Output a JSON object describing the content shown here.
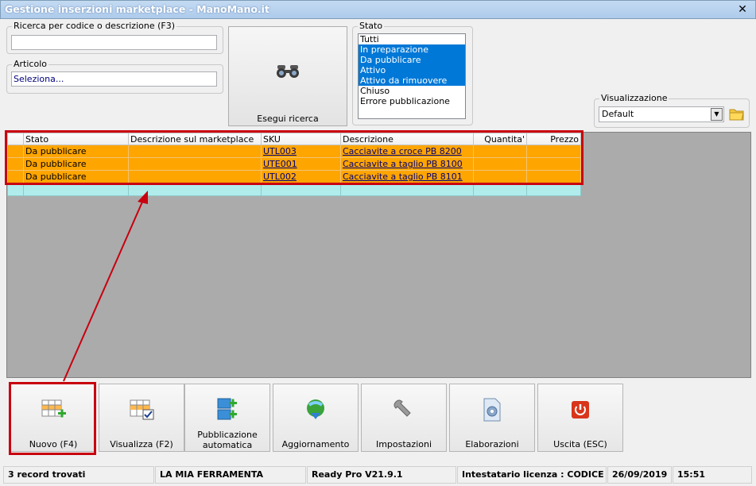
{
  "window": {
    "title": "Gestione inserzioni marketplace - ManoMano.it",
    "close_glyph": "✕"
  },
  "search": {
    "legend": "Ricerca per codice o descrizione (F3)",
    "value": ""
  },
  "article": {
    "legend": "Articolo",
    "value": "Seleziona..."
  },
  "search_button": {
    "label": "Esegui ricerca",
    "icon": "binoculars-icon"
  },
  "stato": {
    "legend": "Stato",
    "options": [
      {
        "label": "Tutti",
        "selected": false
      },
      {
        "label": "In preparazione",
        "selected": true
      },
      {
        "label": "Da pubblicare",
        "selected": true
      },
      {
        "label": "Attivo",
        "selected": true
      },
      {
        "label": "Attivo da rimuovere",
        "selected": true
      },
      {
        "label": "Chiuso",
        "selected": false
      },
      {
        "label": "Errore pubblicazione",
        "selected": false
      }
    ]
  },
  "visualizzazione": {
    "legend": "Visualizzazione",
    "value": "Default"
  },
  "grid": {
    "columns": [
      "Stato",
      "Descrizione sul marketplace",
      "SKU",
      "Descrizione",
      "Quantita'",
      "Prezzo"
    ],
    "rows": [
      {
        "stato": "Da pubblicare",
        "desc_marketplace": "",
        "sku": "UTL003",
        "descrizione": "Cacciavite a croce PB 8200",
        "quantita": "",
        "prezzo": ""
      },
      {
        "stato": "Da pubblicare",
        "desc_marketplace": "",
        "sku": "UTE001",
        "descrizione": "Cacciavite a taglio PB 8100",
        "quantita": "",
        "prezzo": ""
      },
      {
        "stato": "Da pubblicare",
        "desc_marketplace": "",
        "sku": "UTL002",
        "descrizione": "Cacciavite a taglio PB 8101",
        "quantita": "",
        "prezzo": ""
      }
    ]
  },
  "toolbar": {
    "buttons": [
      {
        "label": "Nuovo (F4)",
        "icon": "grid-add-icon"
      },
      {
        "label": "Visualizza (F2)",
        "icon": "grid-check-icon"
      },
      {
        "label": "Pubblicazione automatica",
        "icon": "auto-publish-icon"
      },
      {
        "label": "Aggiornamento",
        "icon": "globe-download-icon"
      },
      {
        "label": "Impostazioni",
        "icon": "wrench-icon"
      },
      {
        "label": "Elaborazioni",
        "icon": "document-gear-icon"
      },
      {
        "label": "Uscita (ESC)",
        "icon": "power-icon"
      }
    ]
  },
  "status": {
    "records": "3 record trovati",
    "company": "LA MIA FERRAMENTA",
    "version": "Ready Pro V21.9.1",
    "license": "Intestatario licenza : CODICE SRL",
    "date": "26/09/2019",
    "time": "15:51"
  },
  "colors": {
    "accent": "#0078d7",
    "row": "#ffa500",
    "highlight": "#c8000f",
    "empty_row": "#b0ecec"
  }
}
